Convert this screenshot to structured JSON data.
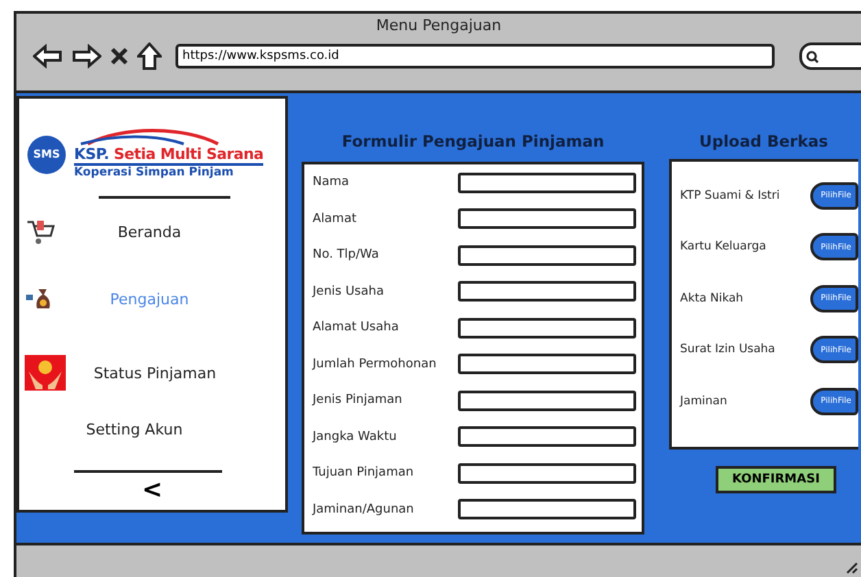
{
  "window": {
    "title": "Menu Pengajuan",
    "url": "https://www.kspsms.co.id"
  },
  "logo": {
    "badge": "SMS",
    "prefix": "KSP.",
    "name": "Setia Multi Sarana",
    "tagline": "Koperasi Simpan Pinjam"
  },
  "sidebar": {
    "items": [
      {
        "label": "Beranda",
        "kind": "cart",
        "selected": false
      },
      {
        "label": "Pengajuan",
        "kind": "moneybag",
        "selected": true
      },
      {
        "label": "Status Pinjaman",
        "kind": "hands",
        "selected": false
      },
      {
        "label": "Setting Akun",
        "kind": "none",
        "selected": false
      }
    ],
    "collapse": "<"
  },
  "form": {
    "title": "Formulir Pengajuan Pinjaman",
    "fields": [
      "Nama",
      "Alamat",
      "No. Tlp/Wa",
      "Jenis Usaha",
      "Alamat Usaha",
      "Jumlah Permohonan",
      "Jenis Pinjaman",
      "Jangka Waktu",
      "Tujuan Pinjaman",
      "Jaminan/Agunan"
    ]
  },
  "upload": {
    "title": "Upload Berkas",
    "files": [
      {
        "label": "KTP Suami & Istri",
        "button": "PilihFile"
      },
      {
        "label": "Kartu Keluarga",
        "button": "PilihFile"
      },
      {
        "label": "Akta Nikah",
        "button": "PilihFile"
      },
      {
        "label": "Surat Izin Usaha",
        "button": "PilihFile"
      },
      {
        "label": "Jaminan",
        "button": "PilihFile"
      }
    ],
    "confirm": "KONFIRMASI"
  }
}
